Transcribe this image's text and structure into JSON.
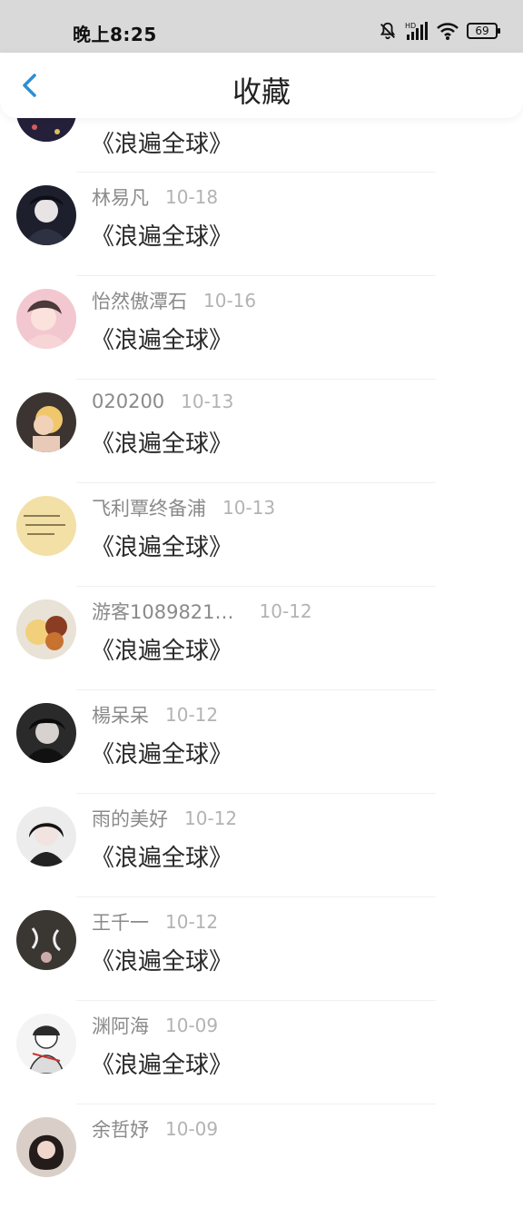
{
  "status": {
    "time": "晚上8:25",
    "battery": "69"
  },
  "header": {
    "title": "收藏"
  },
  "items": [
    {
      "name": "",
      "date": "",
      "title": "《浪遍全球》"
    },
    {
      "name": "林易凡",
      "date": "10-18",
      "title": "《浪遍全球》"
    },
    {
      "name": "怡然傲潭石",
      "date": "10-16",
      "title": "《浪遍全球》"
    },
    {
      "name": "020200",
      "date": "10-13",
      "title": "《浪遍全球》"
    },
    {
      "name": "飞利覃终备浦",
      "date": "10-13",
      "title": "《浪遍全球》"
    },
    {
      "name": "游客1089821…",
      "date": "10-12",
      "title": "《浪遍全球》"
    },
    {
      "name": "楊呆呆",
      "date": "10-12",
      "title": "《浪遍全球》"
    },
    {
      "name": "雨的美好",
      "date": "10-12",
      "title": "《浪遍全球》"
    },
    {
      "name": "王千一",
      "date": "10-12",
      "title": "《浪遍全球》"
    },
    {
      "name": "渊阿海",
      "date": "10-09",
      "title": "《浪遍全球》"
    },
    {
      "name": "余哲妤",
      "date": "10-09",
      "title": ""
    }
  ],
  "colors": {
    "accent": "#2a90d6",
    "status_bar": "#d9d9d9"
  }
}
